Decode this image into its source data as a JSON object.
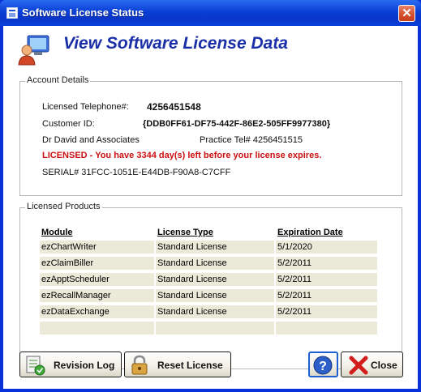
{
  "window": {
    "title": "Software License Status"
  },
  "header": {
    "title": "View Software License Data"
  },
  "account": {
    "group_label": "Account Details",
    "telephone_label": "Licensed Telephone#:",
    "telephone_value": "4256451548",
    "customer_label": "Customer ID:",
    "customer_value": "{DDB0FF61-DF75-442F-86E2-505FF9977380}",
    "practice_name": "Dr David and Associates",
    "practice_tel": "Practice Tel# 4256451515",
    "license_status": "LICENSED - You have 3344 day(s) left before your license expires.",
    "serial": "SERIAL# 31FCC-1051E-E44DB-F90A8-C7CFF"
  },
  "products": {
    "group_label": "Licensed Products",
    "columns": [
      "Module",
      "License Type",
      "Expiration Date"
    ],
    "rows": [
      [
        "ezChartWriter",
        "Standard License",
        "5/1/2020"
      ],
      [
        "ezClaimBiller",
        "Standard License",
        "5/2/2011"
      ],
      [
        "ezApptScheduler",
        "Standard License",
        "5/2/2011"
      ],
      [
        "ezRecallManager",
        "Standard License",
        "5/2/2011"
      ],
      [
        "ezDataExchange",
        "Standard License",
        "5/2/2011"
      ],
      [
        "",
        "",
        ""
      ]
    ]
  },
  "buttons": {
    "revision_log": "Revision Log",
    "reset_license": "Reset License",
    "help": "?",
    "close": "Close"
  },
  "colors": {
    "title_bar": "#0a3fd6",
    "header_title": "#1a2fa8",
    "status_red": "#cc1111",
    "row_bg": "#ebe9d8"
  }
}
